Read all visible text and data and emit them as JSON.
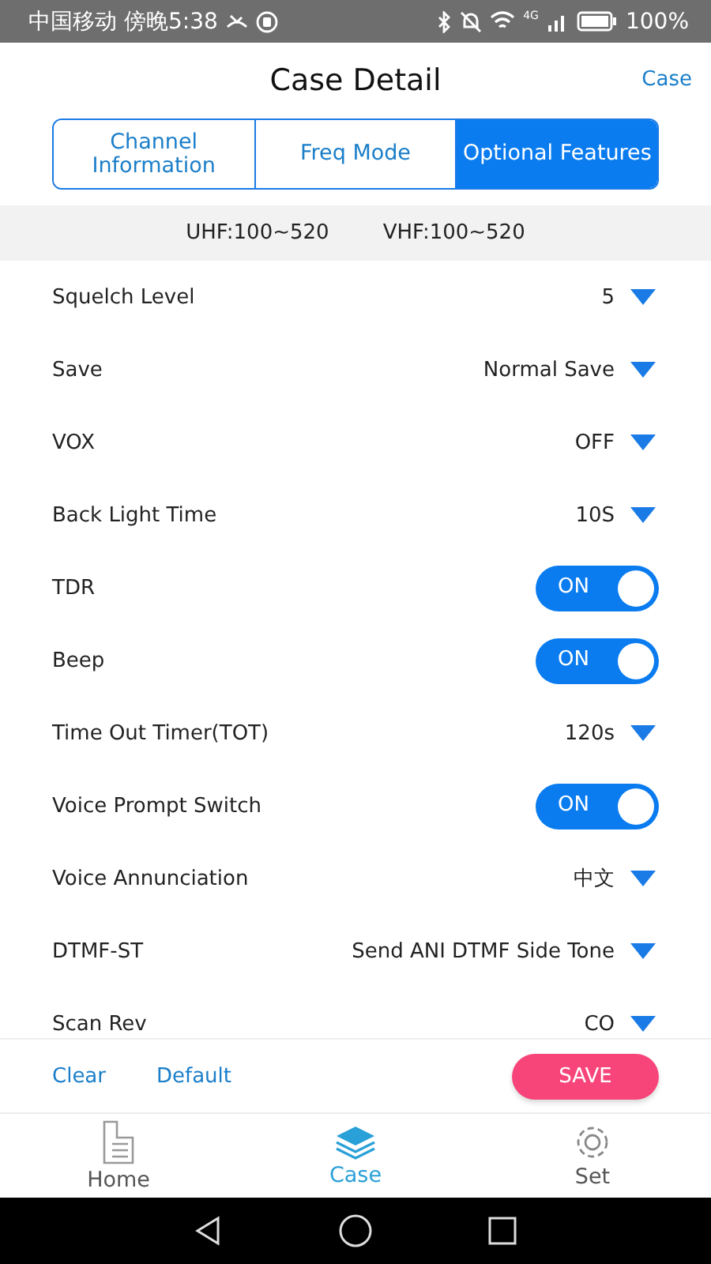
{
  "status_bar": {
    "carrier_time": "中国移动 傍晚5:38",
    "network": "4G",
    "battery": "100%"
  },
  "header": {
    "title": "Case Detail",
    "action": "Case"
  },
  "tabs": [
    {
      "label": "Channel Information",
      "selected": false
    },
    {
      "label": "Freq Mode",
      "selected": false
    },
    {
      "label": "Optional Features",
      "selected": true
    }
  ],
  "ranges": [
    "UHF:100~520",
    "VHF:100~520"
  ],
  "settings": [
    {
      "kind": "dropdown",
      "label": "Squelch Level",
      "value": "5"
    },
    {
      "kind": "dropdown",
      "label": "Save",
      "value": "Normal Save"
    },
    {
      "kind": "dropdown",
      "label": "VOX",
      "value": "OFF"
    },
    {
      "kind": "dropdown",
      "label": "Back Light Time",
      "value": "10S"
    },
    {
      "kind": "toggle",
      "label": "TDR",
      "value": "ON",
      "on": true
    },
    {
      "kind": "toggle",
      "label": "Beep",
      "value": "ON",
      "on": true
    },
    {
      "kind": "dropdown",
      "label": "Time Out Timer(TOT)",
      "value": "120s"
    },
    {
      "kind": "toggle",
      "label": "Voice Prompt Switch",
      "value": "ON",
      "on": true
    },
    {
      "kind": "dropdown",
      "label": "Voice Annunciation",
      "value": "中文"
    },
    {
      "kind": "dropdown",
      "label": "DTMF-ST",
      "value": "Send ANI DTMF Side Tone"
    },
    {
      "kind": "dropdown",
      "label": "Scan Rev",
      "value": "CO"
    }
  ],
  "actions": {
    "clear": "Clear",
    "default": "Default",
    "save": "SAVE"
  },
  "bottom_nav": [
    {
      "kind": "home",
      "label": "Home",
      "selected": false
    },
    {
      "kind": "case",
      "label": "Case",
      "selected": true
    },
    {
      "kind": "set",
      "label": "Set",
      "selected": false
    }
  ]
}
